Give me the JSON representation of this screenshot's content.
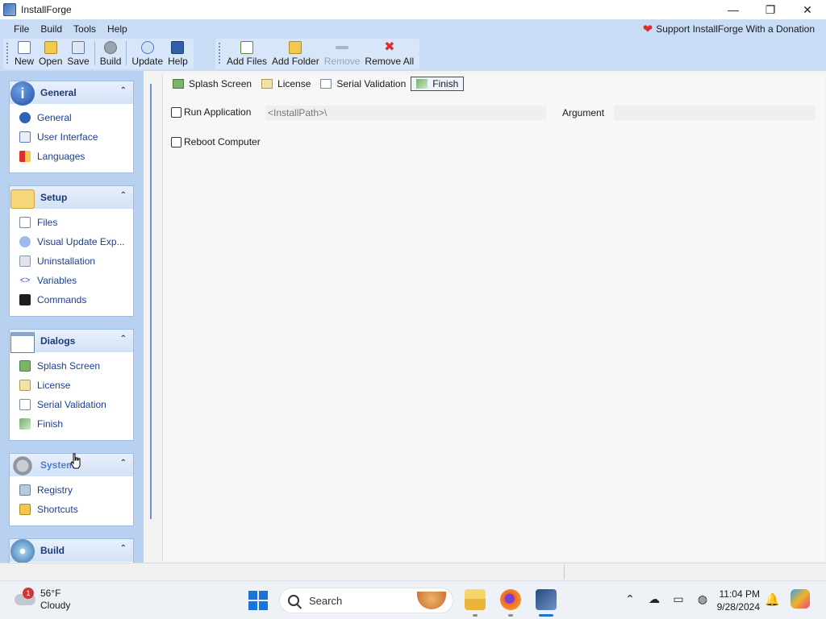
{
  "window": {
    "title": "InstallForge",
    "controls": [
      "minimize",
      "restore",
      "close"
    ]
  },
  "menu": {
    "items": [
      "File",
      "Build",
      "Tools",
      "Help"
    ],
    "donate_label": "Support InstallForge With a Donation"
  },
  "toolbar": {
    "main": [
      {
        "label": "New",
        "icon": "new-file-icon"
      },
      {
        "label": "Open",
        "icon": "open-folder-icon"
      },
      {
        "label": "Save",
        "icon": "save-icon"
      },
      {
        "label": "Build",
        "icon": "build-gear-icon"
      },
      {
        "label": "Update",
        "icon": "update-icon"
      },
      {
        "label": "Help",
        "icon": "help-book-icon"
      }
    ],
    "files": [
      {
        "label": "Add Files",
        "icon": "add-file-icon",
        "enabled": true
      },
      {
        "label": "Add Folder",
        "icon": "add-folder-icon",
        "enabled": true
      },
      {
        "label": "Remove",
        "icon": "remove-icon",
        "enabled": false
      },
      {
        "label": "Remove All",
        "icon": "remove-all-icon",
        "enabled": true
      }
    ]
  },
  "sidebar": {
    "groups": [
      {
        "title": "General",
        "icon": "info-icon",
        "items": [
          "General",
          "User Interface",
          "Languages"
        ]
      },
      {
        "title": "Setup",
        "icon": "folder-icon",
        "items": [
          "Files",
          "Visual Update Exp...",
          "Uninstallation",
          "Variables",
          "Commands"
        ]
      },
      {
        "title": "Dialogs",
        "icon": "dialog-window-icon",
        "items": [
          "Splash Screen",
          "License",
          "Serial Validation",
          "Finish"
        ]
      },
      {
        "title": "System",
        "icon": "gears-icon",
        "items": [
          "Registry",
          "Shortcuts"
        ]
      },
      {
        "title": "Build",
        "icon": "build-disc-icon",
        "items": []
      }
    ]
  },
  "tabs": [
    {
      "label": "Splash Screen",
      "active": false
    },
    {
      "label": "License",
      "active": false
    },
    {
      "label": "Serial Validation",
      "active": false
    },
    {
      "label": "Finish",
      "active": true
    }
  ],
  "finish": {
    "run_application_label": "Run Application",
    "run_application_checked": false,
    "install_path_value": "<InstallPath>\\",
    "argument_label": "Argument",
    "argument_value": "",
    "reboot_label": "Reboot Computer",
    "reboot_checked": false
  },
  "taskbar": {
    "weather_temp": "56°F",
    "weather_desc": "Cloudy",
    "weather_badge": "1",
    "search_placeholder": "Search",
    "time": "11:04 PM",
    "date": "9/28/2024"
  },
  "colors": {
    "accent": "#1c3f8a",
    "toolbar_bg": "#c8dcf6",
    "sidebar_bg": "#b8d1f0"
  }
}
